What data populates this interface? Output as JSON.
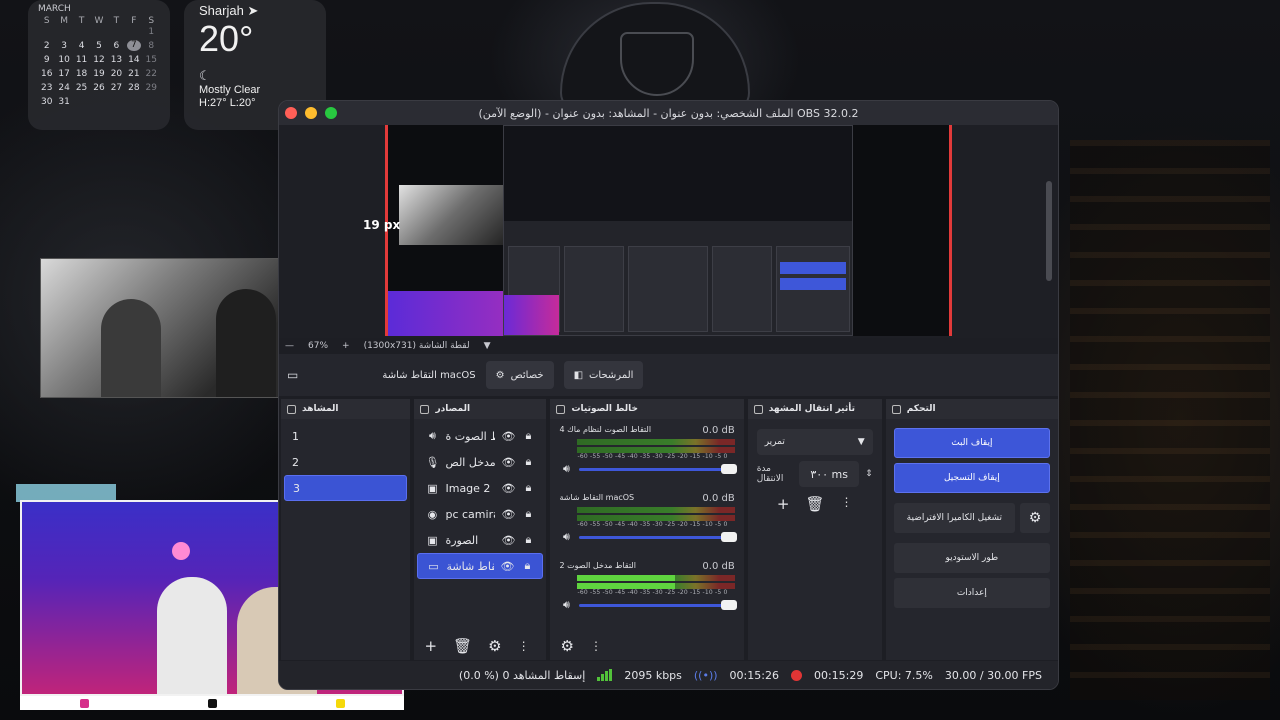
{
  "calendar": {
    "month": "MARCH",
    "weekdays": [
      "S",
      "M",
      "T",
      "W",
      "T",
      "F",
      "S"
    ],
    "weeks": [
      [
        "",
        "",
        "",
        "",
        "",
        "",
        "1"
      ],
      [
        "2",
        "3",
        "4",
        "5",
        "6",
        "7",
        "8"
      ],
      [
        "9",
        "10",
        "11",
        "12",
        "13",
        "14",
        "15"
      ],
      [
        "16",
        "17",
        "18",
        "19",
        "20",
        "21",
        "22"
      ],
      [
        "23",
        "24",
        "25",
        "26",
        "27",
        "28",
        "29"
      ],
      [
        "30",
        "31",
        "",
        "",
        "",
        "",
        ""
      ]
    ],
    "today": "7"
  },
  "weather": {
    "city": "Sharjah",
    "temperature": "20°",
    "condition": "Mostly Clear",
    "high_low": "H:27° L:20°"
  },
  "window": {
    "title": "الملف الشخصي: بدون عنوان - المشاهد: بدون عنوان - (الوضع الآمن) OBS 32.0.2"
  },
  "preview": {
    "distance_label": "19 px",
    "zoom": "67%",
    "resolution": "(1300x731) لقطة الشاشة"
  },
  "toolbar": {
    "filters_label": "المرشحات",
    "properties_label": "خصائص",
    "source_name": "التقاط شاشة macOS"
  },
  "scenes": {
    "title": "المشاهد",
    "items": [
      "1",
      "2",
      "3"
    ],
    "selected_index": 2
  },
  "sources": {
    "title": "المصادر",
    "items": [
      {
        "label": "التقاط الصوت ة",
        "icon": "speaker-icon"
      },
      {
        "label": "التقاط مدخل الص",
        "icon": "microphone-icon"
      },
      {
        "label": "Image 2",
        "icon": "image-icon"
      },
      {
        "label": "pc camira",
        "icon": "camera-icon"
      },
      {
        "label": "الصورة",
        "icon": "image-icon"
      },
      {
        "label": "التقاط شاشة OS",
        "icon": "monitor-icon"
      }
    ]
  },
  "mixer": {
    "title": "خالط الصوتيات",
    "scale": "-60 -55 -50 -45 -40 -35 -30 -25 -20 -15 -10 -5 0",
    "channels": [
      {
        "name": "التقاط الصوت لنظام ماك 4",
        "db": "0.0 dB",
        "level": 0.0,
        "volume": 1.0
      },
      {
        "name": "التقاط شاشة macOS",
        "db": "0.0 dB",
        "level": 0.0,
        "volume": 1.0
      },
      {
        "name": "التقاط مدخل الصوت 2",
        "db": "0.0 dB",
        "level": 0.62,
        "volume": 1.0
      }
    ]
  },
  "transitions": {
    "title": "تأثير انتقال المشهد",
    "selected": "تمرير",
    "duration_label": "مدة الانتقال",
    "duration_value": "٣٠٠ ms"
  },
  "controls": {
    "title": "التحكم",
    "stop_stream": "إيقاف البث",
    "stop_recording": "إيقاف التسجيل",
    "virtual_camera": "تشغيل الكاميرا الافتراضية",
    "studio_mode": "طور الاستوديو",
    "settings": "إعدادات"
  },
  "status": {
    "dropped": "(0.0 %) إسقاط المشاهد 0",
    "bitrate": "2095 kbps",
    "stream_time": "00:15:26",
    "record_time": "00:15:29",
    "cpu": "CPU: 7.5%",
    "fps": "30.00 / 30.00 FPS"
  },
  "colors": {
    "accent": "#3d56d8",
    "record": "#e13535",
    "meter_green": "#4fbe33"
  }
}
